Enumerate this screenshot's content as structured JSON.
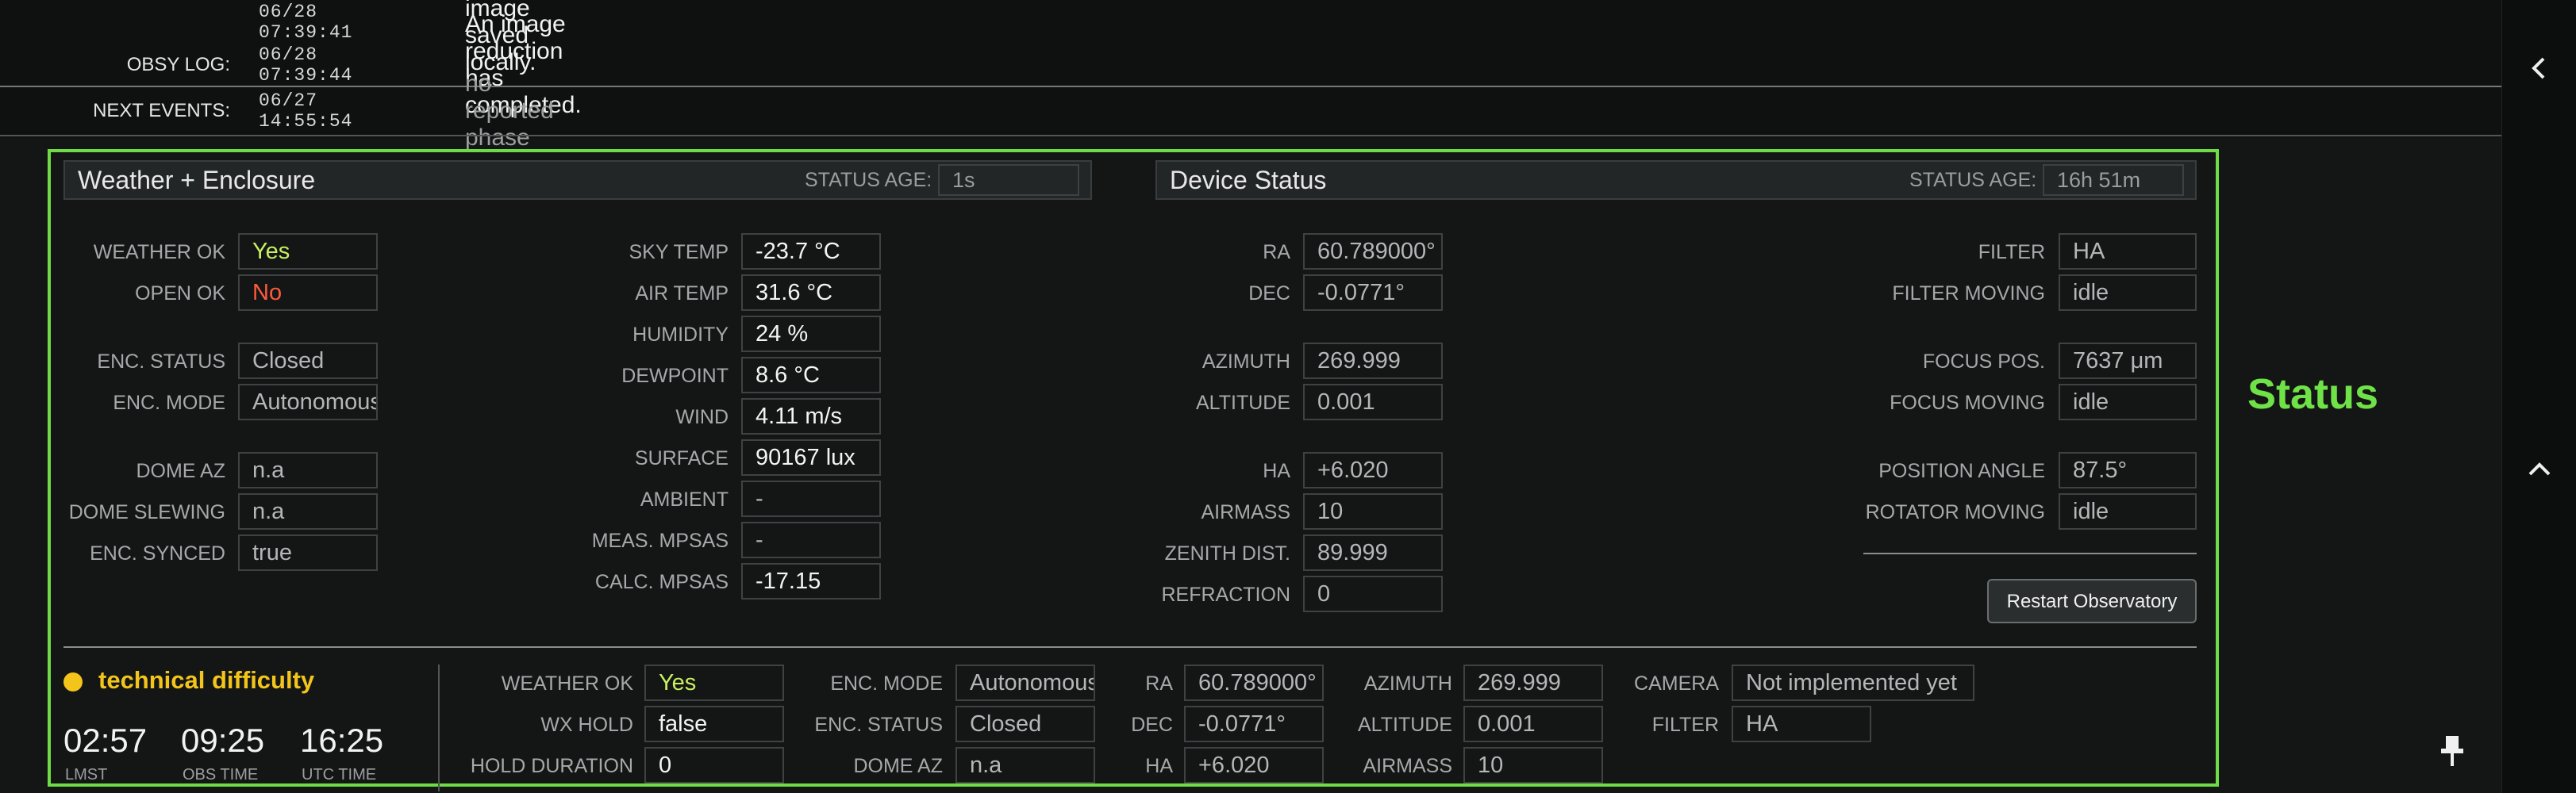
{
  "log": {
    "entries": [
      {
        "label": "",
        "time": "06/28 07:39:41",
        "message": "Raw image saved locally."
      },
      {
        "label": "OBSY LOG:",
        "time": "06/28 07:39:44",
        "message": "An image reduction has completed."
      }
    ],
    "next_events": {
      "label": "NEXT EVENTS:",
      "time": "06/27 14:55:54",
      "message": "no reported phase"
    }
  },
  "weather": {
    "title": "Weather + Enclosure",
    "age_label": "STATUS AGE:",
    "age_value": "1s",
    "fields_left": [
      {
        "label": "WEATHER OK",
        "value": "Yes"
      },
      {
        "label": "OPEN OK",
        "value": "No"
      },
      {
        "label": "ENC. STATUS",
        "value": "Closed"
      },
      {
        "label": "ENC. MODE",
        "value": "Autonomous!"
      },
      {
        "label": "DOME AZ",
        "value": "n.a"
      },
      {
        "label": "DOME SLEWING",
        "value": "n.a"
      },
      {
        "label": "ENC. SYNCED",
        "value": "true"
      }
    ],
    "fields_right": [
      {
        "label": "SKY TEMP",
        "value": "-23.7 °C"
      },
      {
        "label": "AIR TEMP",
        "value": "31.6 °C"
      },
      {
        "label": "HUMIDITY",
        "value": "24 %"
      },
      {
        "label": "DEWPOINT",
        "value": "8.6 °C"
      },
      {
        "label": "WIND",
        "value": "4.11 m/s"
      },
      {
        "label": "SURFACE",
        "value": "90167 lux"
      },
      {
        "label": "AMBIENT",
        "value": "-"
      },
      {
        "label": "MEAS. MPSAS",
        "value": "-"
      },
      {
        "label": "CALC. MPSAS",
        "value": "-17.15"
      }
    ]
  },
  "device": {
    "title": "Device Status",
    "age_label": "STATUS AGE:",
    "age_value": "16h 51m",
    "mount": [
      {
        "label": "RA",
        "value": "60.789000°"
      },
      {
        "label": "DEC",
        "value": "-0.0771°"
      },
      {
        "label": "AZIMUTH",
        "value": "269.999"
      },
      {
        "label": "ALTITUDE",
        "value": "0.001"
      },
      {
        "label": "HA",
        "value": "+6.020"
      },
      {
        "label": "AIRMASS",
        "value": "10"
      },
      {
        "label": "ZENITH DIST.",
        "value": "89.999"
      },
      {
        "label": "REFRACTION",
        "value": "0"
      }
    ],
    "optics": [
      {
        "label": "FILTER",
        "value": "HA"
      },
      {
        "label": "FILTER MOVING",
        "value": "idle"
      },
      {
        "label": "FOCUS POS.",
        "value": "7637 μm"
      },
      {
        "label": "FOCUS MOVING",
        "value": "idle"
      },
      {
        "label": "POSITION ANGLE",
        "value": "87.5°"
      },
      {
        "label": "ROTATOR MOVING",
        "value": "idle"
      }
    ],
    "restart_label": "Restart Observatory"
  },
  "status_heading": "Status",
  "summary": {
    "state": "technical difficulty",
    "state_color": "#f3c51b",
    "clocks": [
      {
        "value": "02:57",
        "label": "LMST"
      },
      {
        "value": "09:25",
        "label": "OBS TIME"
      },
      {
        "value": "16:25",
        "label": "UTC TIME"
      }
    ],
    "col1": [
      {
        "label": "WEATHER OK",
        "value": "Yes"
      },
      {
        "label": "WX HOLD",
        "value": "false"
      },
      {
        "label": "HOLD DURATION",
        "value": "0"
      }
    ],
    "col2": [
      {
        "label": "ENC. MODE",
        "value": "Autonomous!"
      },
      {
        "label": "ENC. STATUS",
        "value": "Closed"
      },
      {
        "label": "DOME AZ",
        "value": "n.a"
      }
    ],
    "col3": [
      {
        "label": "RA",
        "value": "60.789000°"
      },
      {
        "label": "DEC",
        "value": "-0.0771°"
      },
      {
        "label": "HA",
        "value": "+6.020"
      }
    ],
    "col4": [
      {
        "label": "AZIMUTH",
        "value": "269.999"
      },
      {
        "label": "ALTITUDE",
        "value": "0.001"
      },
      {
        "label": "AIRMASS",
        "value": "10"
      }
    ],
    "col5": [
      {
        "label": "CAMERA",
        "value": "Not implemented yet"
      },
      {
        "label": "FILTER",
        "value": "HA"
      }
    ]
  },
  "icons": {
    "collapse": "chevron-left-icon",
    "expand": "chevron-up-icon",
    "pin": "pin-icon"
  },
  "colors": {
    "accent": "#6fdc45",
    "ok": "#c8f060",
    "bad": "#ff5a3c"
  }
}
